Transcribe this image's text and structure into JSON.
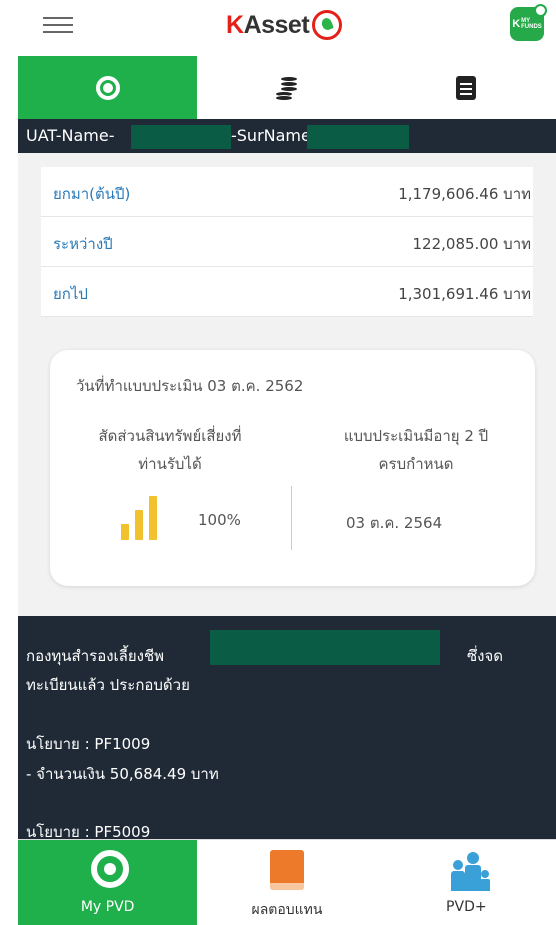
{
  "header": {
    "menu_icon": "hamburger-icon",
    "logo_text": "KAsset",
    "logo_icon": "kasikorn-leaf-icon",
    "app_icon_text": "K MY FUNDS"
  },
  "tabs": [
    {
      "icon": "my-pvd-icon",
      "active": true
    },
    {
      "icon": "coins-icon",
      "active": false
    },
    {
      "icon": "document-icon",
      "active": false
    }
  ],
  "user": {
    "name_prefix": "UAT-Name-",
    "surname_label": "-SurName"
  },
  "summary": [
    {
      "label": "ยกมา(ต้นปี)",
      "value": "1,179,606.46 บาท"
    },
    {
      "label": "ระหว่างปี",
      "value": "122,085.00 บาท"
    },
    {
      "label": "ยกไป",
      "value": "1,301,691.46 บาท"
    }
  ],
  "risk_card": {
    "assess_date": "วันที่ทำแบบประเมิน 03 ต.ค. 2562",
    "risk_title_line1": "สัดส่วนสินทรัพย์เสี่ยงที่",
    "risk_title_line2": "ท่านรับได้",
    "risk_value": "100%",
    "expiry_title_line1": "แบบประเมินมีอายุ 2 ปี",
    "expiry_title_line2": "ครบกำหนด",
    "expiry_value": "03 ต.ค. 2564"
  },
  "fund": {
    "line1_prefix": "กองทุนสำรองเลี้ยงชีพ",
    "line1_suffix": "ซึ่งจด",
    "line2": "ทะเบียนแล้ว ประกอบด้วย",
    "policies": [
      {
        "policy": "นโยบาย : PF1009",
        "amount": " - จำนวนเงิน 50,684.49 บาท"
      },
      {
        "policy": "นโยบาย : PF5009"
      }
    ]
  },
  "bottom_nav": [
    {
      "label": "My PVD",
      "icon": "my-pvd-icon",
      "active": true
    },
    {
      "label": "ผลตอบแทน",
      "icon": "book-icon",
      "active": false
    },
    {
      "label": "PVD+",
      "icon": "family-icon",
      "active": false
    }
  ],
  "colors": {
    "brand_green": "#1fb04b",
    "dark_navy": "#1f2a36",
    "link_blue": "#2a7ab8",
    "redaction": "#0b5c45",
    "risk_yellow": "#f2c12e"
  }
}
